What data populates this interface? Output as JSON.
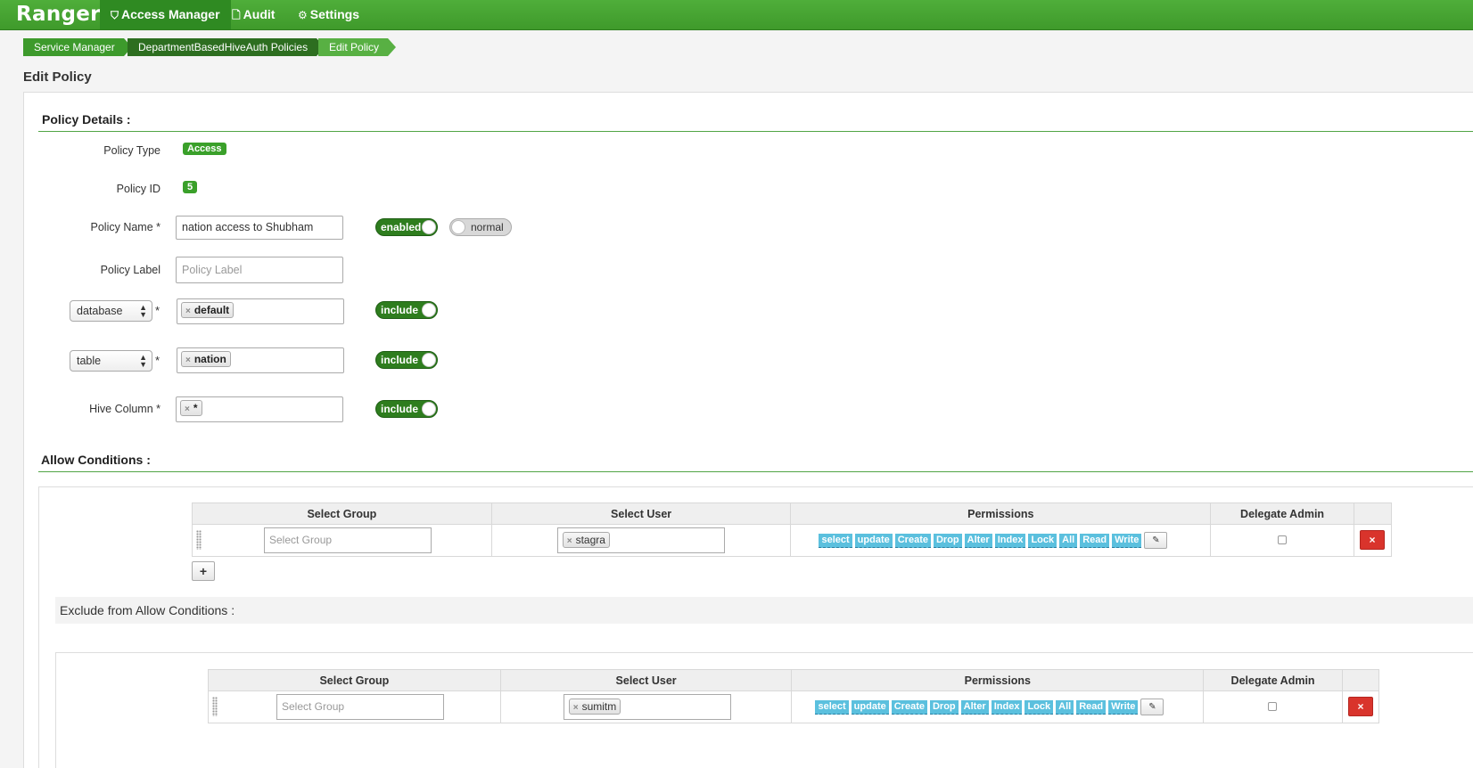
{
  "navbar": {
    "brand": "Ranger",
    "items": [
      {
        "label": "Access Manager",
        "icon": "shield-icon"
      },
      {
        "label": "Audit",
        "icon": "file-icon"
      },
      {
        "label": "Settings",
        "icon": "gear-icon"
      }
    ]
  },
  "breadcrumb": [
    "Service Manager",
    "DepartmentBasedHiveAuth Policies",
    "Edit Policy"
  ],
  "page_title": "Edit Policy",
  "policy_details": {
    "title": "Policy Details :",
    "policy_type_label": "Policy Type",
    "policy_type": "Access",
    "policy_id_label": "Policy ID",
    "policy_id": "5",
    "policy_name_label": "Policy Name *",
    "policy_name": "nation access to Shubham",
    "enabled_toggle": "enabled",
    "audit_toggle": "normal",
    "policy_label_label": "Policy Label",
    "policy_label_placeholder": "Policy Label",
    "resources": [
      {
        "select": "database",
        "value": "default",
        "toggle": "include"
      },
      {
        "select": "table",
        "value": "nation",
        "toggle": "include"
      }
    ],
    "hive_column_label": "Hive Column *",
    "hive_column_value": "*",
    "hive_column_toggle": "include",
    "required_mark": "*"
  },
  "allow_conditions": {
    "title": "Allow Conditions :",
    "columns": [
      "Select Group",
      "Select User",
      "Permissions",
      "Delegate Admin"
    ],
    "row": {
      "group_placeholder": "Select Group",
      "user": "stagra",
      "permissions": [
        "select",
        "update",
        "Create",
        "Drop",
        "Alter",
        "Index",
        "Lock",
        "All",
        "Read",
        "Write"
      ]
    },
    "add_label": "+"
  },
  "exclude_conditions": {
    "title": "Exclude from Allow Conditions :",
    "columns": [
      "Select Group",
      "Select User",
      "Permissions",
      "Delegate Admin"
    ],
    "row": {
      "group_placeholder": "Select Group",
      "user": "sumitm",
      "permissions": [
        "select",
        "update",
        "Create",
        "Drop",
        "Alter",
        "Index",
        "Lock",
        "All",
        "Read",
        "Write"
      ]
    }
  },
  "icons": {
    "delete": "×",
    "edit": "✎",
    "tag_remove": "×"
  }
}
